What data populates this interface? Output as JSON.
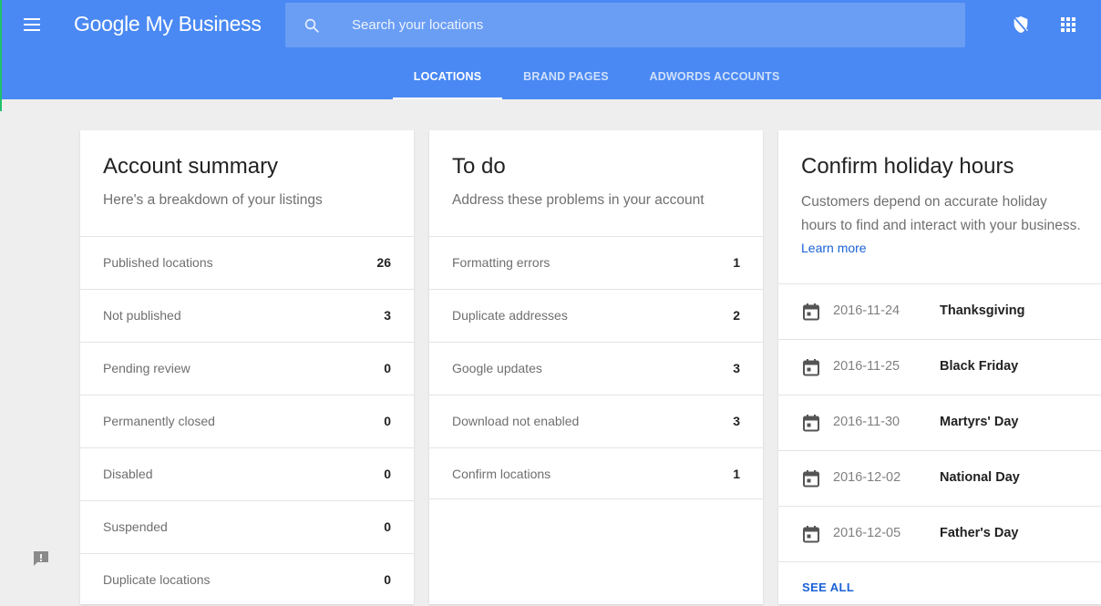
{
  "header": {
    "brand": "Google My Business",
    "search_placeholder": "Search your locations",
    "tabs": [
      {
        "label": "LOCATIONS",
        "active": true
      },
      {
        "label": "BRAND PAGES",
        "active": false
      },
      {
        "label": "ADWORDS ACCOUNTS",
        "active": false
      }
    ],
    "icons": [
      "menu-icon",
      "search-icon",
      "shield-icon",
      "apps-grid-icon"
    ],
    "colors": {
      "bar": "#4a89f3",
      "search_bg": "#6a9ef5"
    }
  },
  "account_summary": {
    "title": "Account summary",
    "subtitle": "Here's a breakdown of your listings",
    "rows": [
      {
        "label": "Published locations",
        "count": "26"
      },
      {
        "label": "Not published",
        "count": "3"
      },
      {
        "label": "Pending review",
        "count": "0"
      },
      {
        "label": "Permanently closed",
        "count": "0"
      },
      {
        "label": "Disabled",
        "count": "0"
      },
      {
        "label": "Suspended",
        "count": "0"
      },
      {
        "label": "Duplicate locations",
        "count": "0"
      }
    ]
  },
  "todo": {
    "title": "To do",
    "subtitle": "Address these problems in your account",
    "rows": [
      {
        "label": "Formatting errors",
        "count": "1"
      },
      {
        "label": "Duplicate addresses",
        "count": "2"
      },
      {
        "label": "Google updates",
        "count": "3"
      },
      {
        "label": "Download not enabled",
        "count": "3"
      },
      {
        "label": "Confirm locations",
        "count": "1"
      }
    ]
  },
  "holiday": {
    "title": "Confirm holiday hours",
    "description": "Customers depend on accurate holiday hours to find and interact with your business.",
    "learn_more": "Learn more",
    "rows": [
      {
        "date": "2016-11-24",
        "name": "Thanksgiving"
      },
      {
        "date": "2016-11-25",
        "name": "Black Friday"
      },
      {
        "date": "2016-11-30",
        "name": "Martyrs' Day"
      },
      {
        "date": "2016-12-02",
        "name": "National Day"
      },
      {
        "date": "2016-12-05",
        "name": "Father's Day"
      }
    ],
    "see_all": "SEE ALL",
    "link_color": "#1a62d6"
  },
  "feedback": {
    "icon": "feedback-icon"
  }
}
